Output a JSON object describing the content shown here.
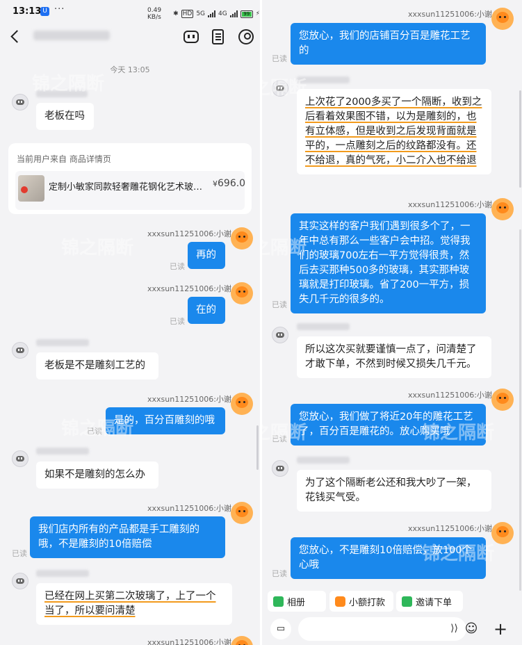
{
  "status_bar": {
    "time": "13:13",
    "app_badge": "U",
    "more": "···",
    "net_speed": "0.49 KB/s",
    "bt": "✱",
    "hd": "HD",
    "net1": "5G",
    "net2": "4G",
    "battery": "99",
    "charging": "⚡"
  },
  "left": {
    "timestamp": "今天 13:05",
    "product_from": "当前用户来自 商品详情页",
    "product_title": "定制小敏家同款轻奢雕花钢化艺术玻璃隔断",
    "product_price_symbol": "¥",
    "product_price": "696.0",
    "seller_nick": "xxxsun11251006:小谢",
    "read": "已读",
    "messages": {
      "m1": "老板在吗",
      "m2": "再的",
      "m3": "在的",
      "m4": "老板是不是雕刻工艺的",
      "m5": "是的，百分百雕刻的哦",
      "m6": "如果不是雕刻的怎么办",
      "m7": "我们店内所有的产品都是手工雕刻的哦，不是雕刻的10倍赔偿",
      "m8": "已经在网上买第二次玻璃了，上了一个当了，所以要问清楚"
    }
  },
  "right": {
    "seller_nick": "xxxsun11251006:小谢",
    "read": "已读",
    "messages": {
      "r1": "您放心，我们的店铺百分百是雕花工艺的",
      "r2": "上次花了2000多买了一个隔断，收到之后看着效果图不错，以为是雕刻的，也有立体感，但是收到之后发现背面就是平的，一点雕刻之后的纹路都没有。还不给退，真的气死，小二介入也不给退",
      "r3": "其实这样的客户我们遇到很多个了，一年中总有那么一些客户会中招。觉得我们的玻璃700左右一平方觉得很贵，然后去买那种500多的玻璃，其实那种玻璃就是打印玻璃。省了200一平方，损失几千元的很多的。",
      "r4": "所以这次买就要谨慎一点了，问清楚了才敢下单，不然到时候又损失几千元。",
      "r5": "您放心，我们做了将近20年的雕花工艺了，百分百是雕花的。放心购买哦",
      "r6": "为了这个隔断老公还和我大吵了一架，花钱买气受。",
      "r7": "您放心，不是雕刻10倍赔偿，放100个心哦"
    },
    "quick_actions": {
      "album": "相册",
      "tip": "小额打款",
      "invite": "邀请下单"
    }
  },
  "watermark": "锦之隔断",
  "colors": {
    "bubble_out": "#1a88ec",
    "underline": "#f29a1c",
    "background": "#f3f3f5"
  }
}
